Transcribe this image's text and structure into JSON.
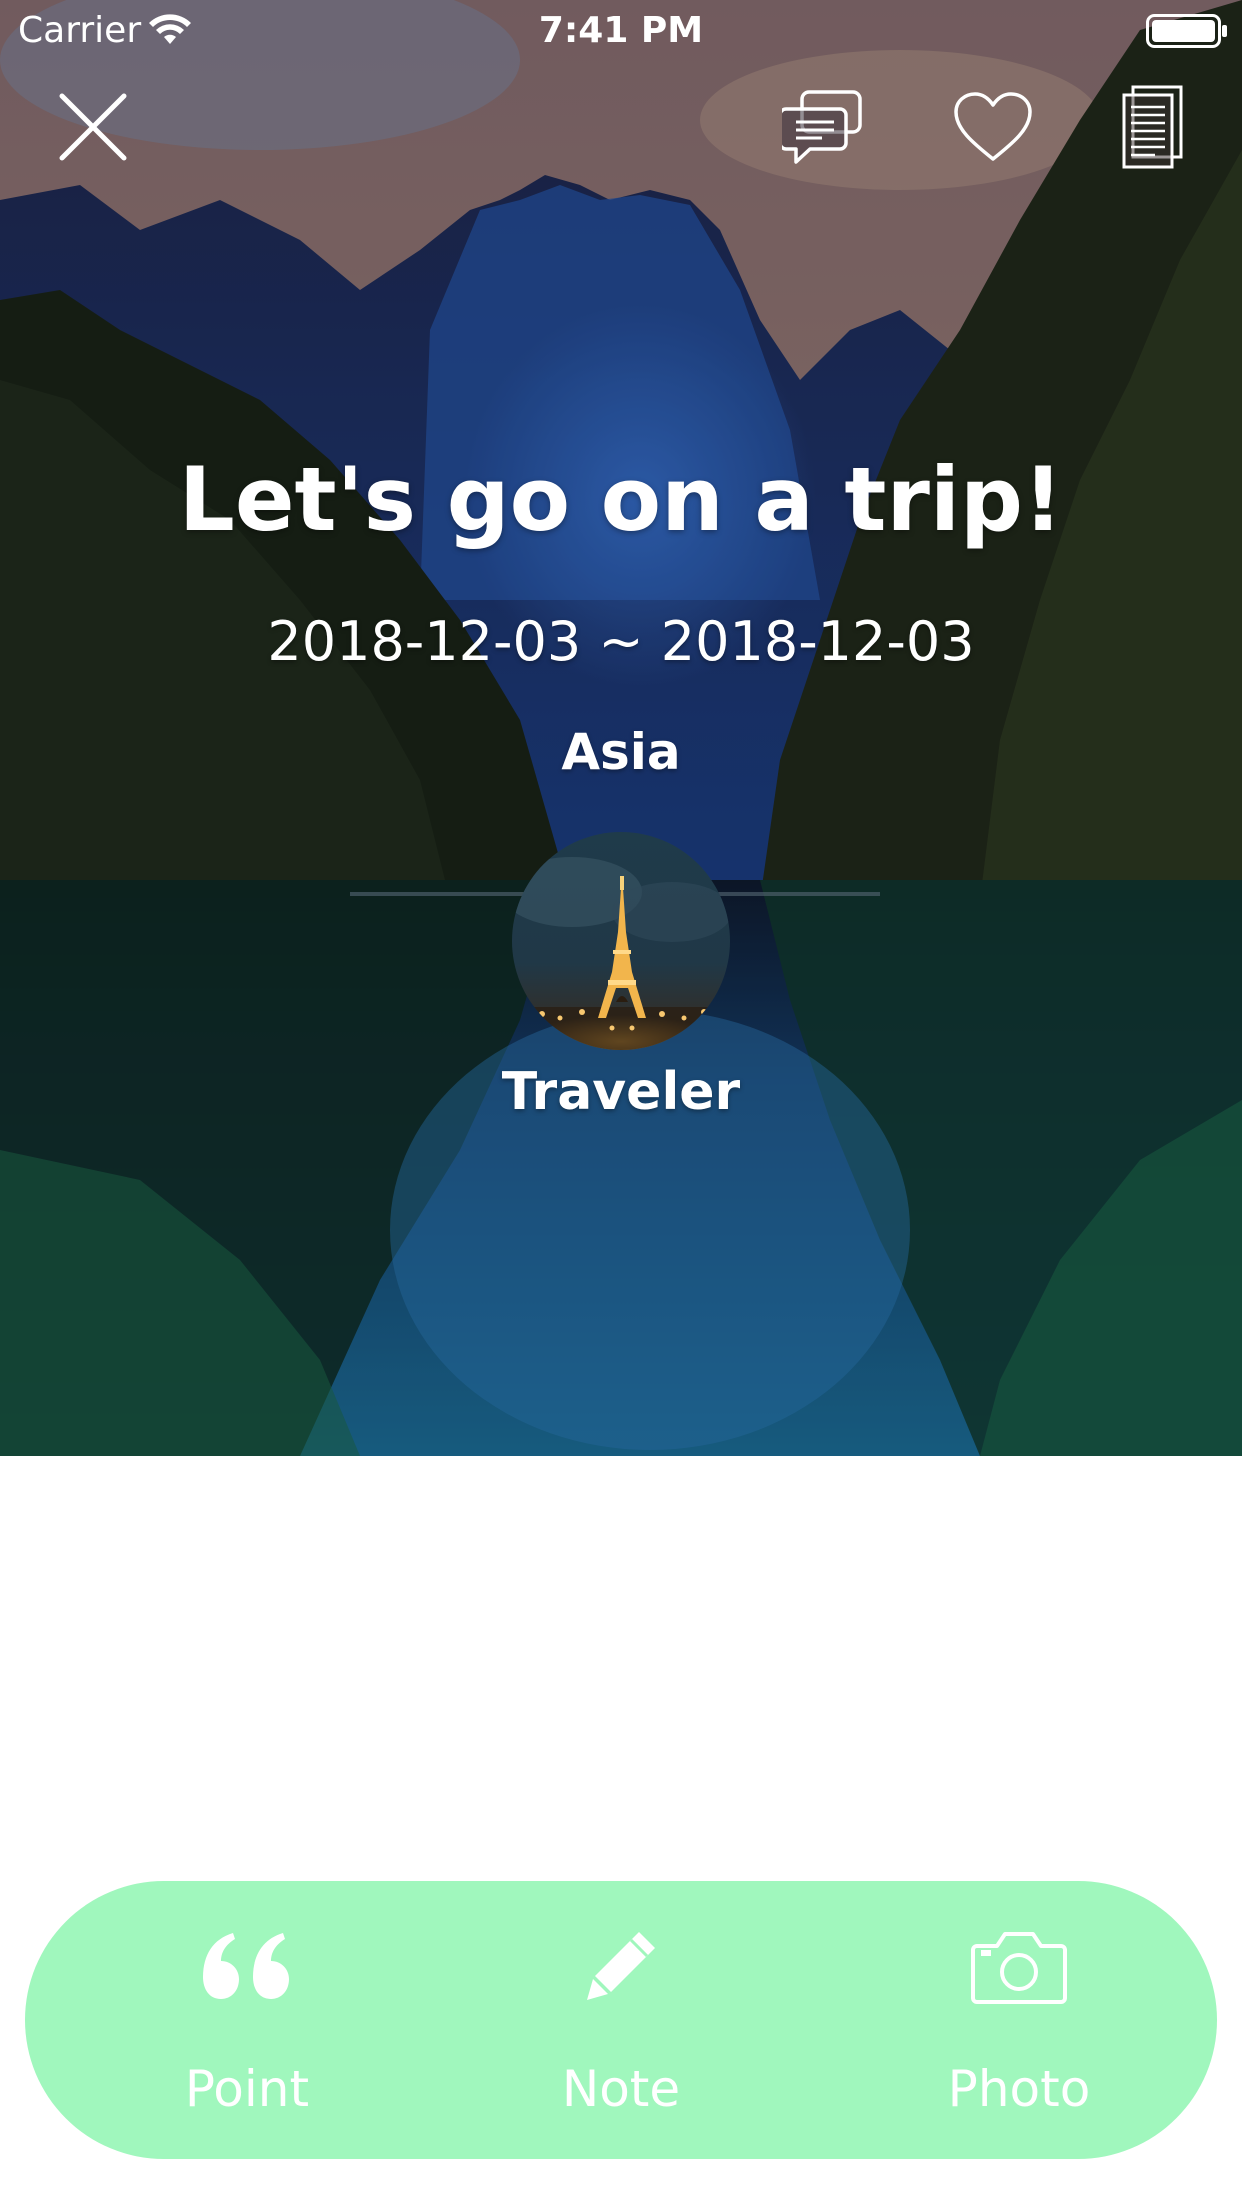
{
  "status_bar": {
    "carrier": "Carrier",
    "time": "7:41 PM"
  },
  "nav": {
    "icons": [
      "close-icon",
      "comments-icon",
      "heart-icon",
      "document-icon"
    ]
  },
  "trip": {
    "title": "Let's go on a trip!",
    "dates": "2018-12-03 ~ 2018-12-03",
    "region": "Asia",
    "traveler": "Traveler"
  },
  "actions": [
    {
      "label": "Point",
      "icon": "quote-icon"
    },
    {
      "label": "Note",
      "icon": "pencil-icon"
    },
    {
      "label": "Photo",
      "icon": "camera-icon"
    }
  ],
  "colors": {
    "action_bar": "#a0f7bd",
    "text_on_cover": "#ffffff"
  }
}
